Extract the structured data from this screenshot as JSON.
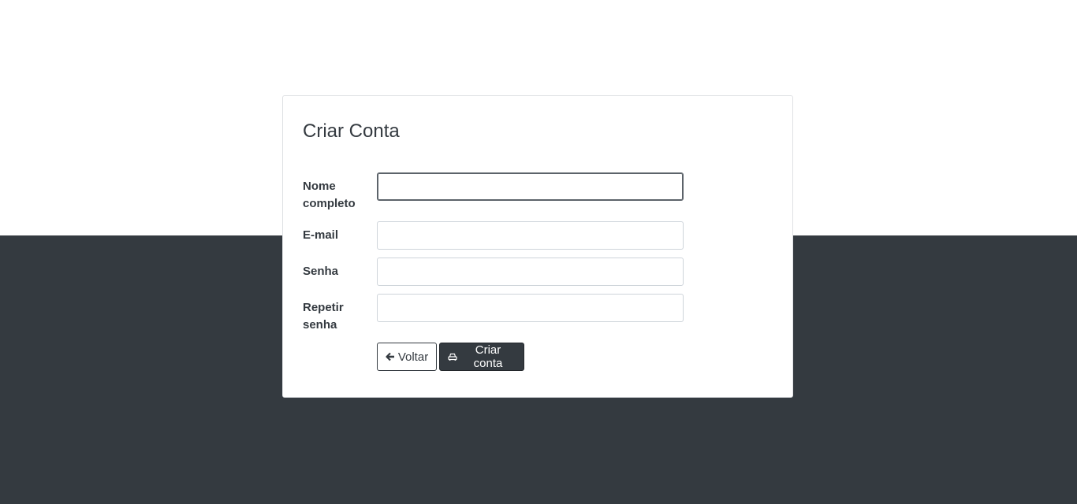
{
  "card": {
    "title": "Criar Conta"
  },
  "form": {
    "fields": [
      {
        "label_line1": "Nome",
        "label_line2": "completo",
        "value": ""
      },
      {
        "label": "E-mail",
        "value": ""
      },
      {
        "label": "Senha",
        "value": ""
      },
      {
        "label_line1": "Repetir",
        "label_line2": "senha",
        "value": ""
      }
    ],
    "back_label": "Voltar",
    "create_label": "Criar conta",
    "back_icon": "arrow-left-icon",
    "create_icon": "car-icon"
  },
  "colors": {
    "dark": "#343a40",
    "background": "#ffffff"
  }
}
